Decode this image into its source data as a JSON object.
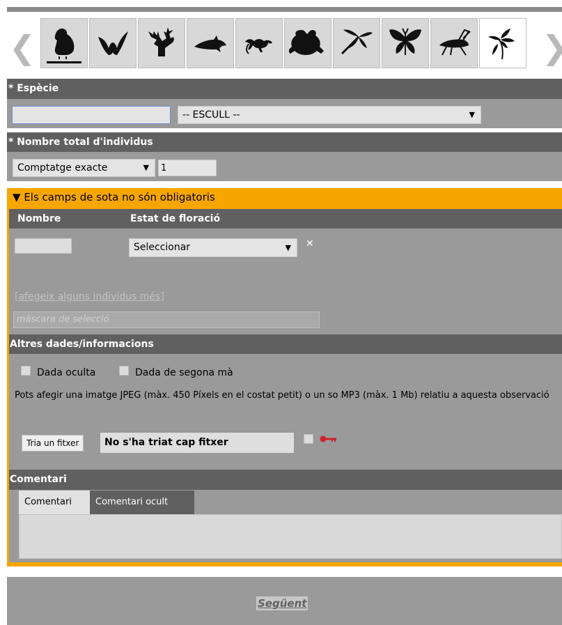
{
  "taxa": {
    "prev_arrow": "❮",
    "next_arrow": "❯",
    "icons": [
      "bird-icon",
      "bat-icon",
      "deer-icon",
      "dolphin-icon",
      "lizard-icon",
      "frog-icon",
      "dragonfly-icon",
      "butterfly-icon",
      "grasshopper-icon",
      "orchid-icon"
    ],
    "active_index": 9
  },
  "especie": {
    "label": "* Espècie",
    "input_value": "",
    "select_value": "-- ESCULL --"
  },
  "nombre_total": {
    "label": "* Nombre total d'individus",
    "count_type": "Comptatge exacte",
    "count_value": "1"
  },
  "optional": {
    "title": "Els camps de sota no són obligatoris",
    "col_nombre": "Nombre",
    "col_floracio": "Estat de floració",
    "nombre_value": "",
    "floracio_select": "Seleccionar",
    "remove_symbol": "✕",
    "add_more_link": "[afegeix alguns individus més]",
    "mask_placeholder": "màscara de selecció"
  },
  "altres": {
    "label": "Altres dades/informacions",
    "dada_oculta": "Dada oculta",
    "dada_segona": "Dada de segona mà",
    "info_text": "Pots afegir una imatge JPEG (màx. 450 Píxels en el costat petit) o un so MP3 (màx. 1 Mb) relatiu a aquesta observació",
    "file_button": "Tria un fitxer",
    "file_name": "No s'ha triat cap fitxer"
  },
  "comentari": {
    "label": "Comentari",
    "tab_1": "Comentari",
    "tab_2": "Comentari ocult",
    "text": ""
  },
  "footer": {
    "next_label": "Següent"
  },
  "colors": {
    "accent_orange": "#f7a600",
    "bar_dark": "#606060",
    "panel_gray": "#9a9a9a",
    "key_red": "#d0232a"
  }
}
